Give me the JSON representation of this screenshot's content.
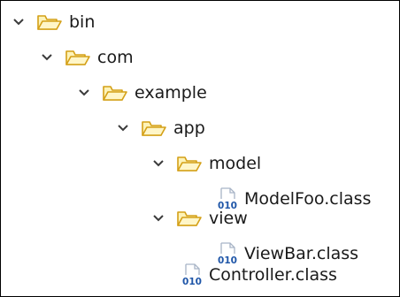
{
  "colors": {
    "folder_stroke": "#d4a017",
    "folder_fill": "#fdf3b8",
    "chevron": "#3b3b3b",
    "class_text": "#1f56a8",
    "class_frame": "#a8b4c6"
  },
  "tree": {
    "bin": {
      "label": "bin",
      "expanded": true,
      "icon": "open-folder-icon"
    },
    "com": {
      "label": "com",
      "expanded": true,
      "icon": "open-folder-icon"
    },
    "example": {
      "label": "example",
      "expanded": true,
      "icon": "open-folder-icon"
    },
    "app": {
      "label": "app",
      "expanded": true,
      "icon": "open-folder-icon"
    },
    "model": {
      "label": "model",
      "expanded": true,
      "icon": "open-folder-icon"
    },
    "modelfoo": {
      "label": "ModelFoo.class",
      "icon": "class-file-icon",
      "icon_text": "010"
    },
    "view": {
      "label": "view",
      "expanded": true,
      "icon": "open-folder-icon"
    },
    "viewbar": {
      "label": "ViewBar.class",
      "icon": "class-file-icon",
      "icon_text": "010"
    },
    "controller": {
      "label": "Controller.class",
      "icon": "class-file-icon",
      "icon_text": "010"
    }
  }
}
